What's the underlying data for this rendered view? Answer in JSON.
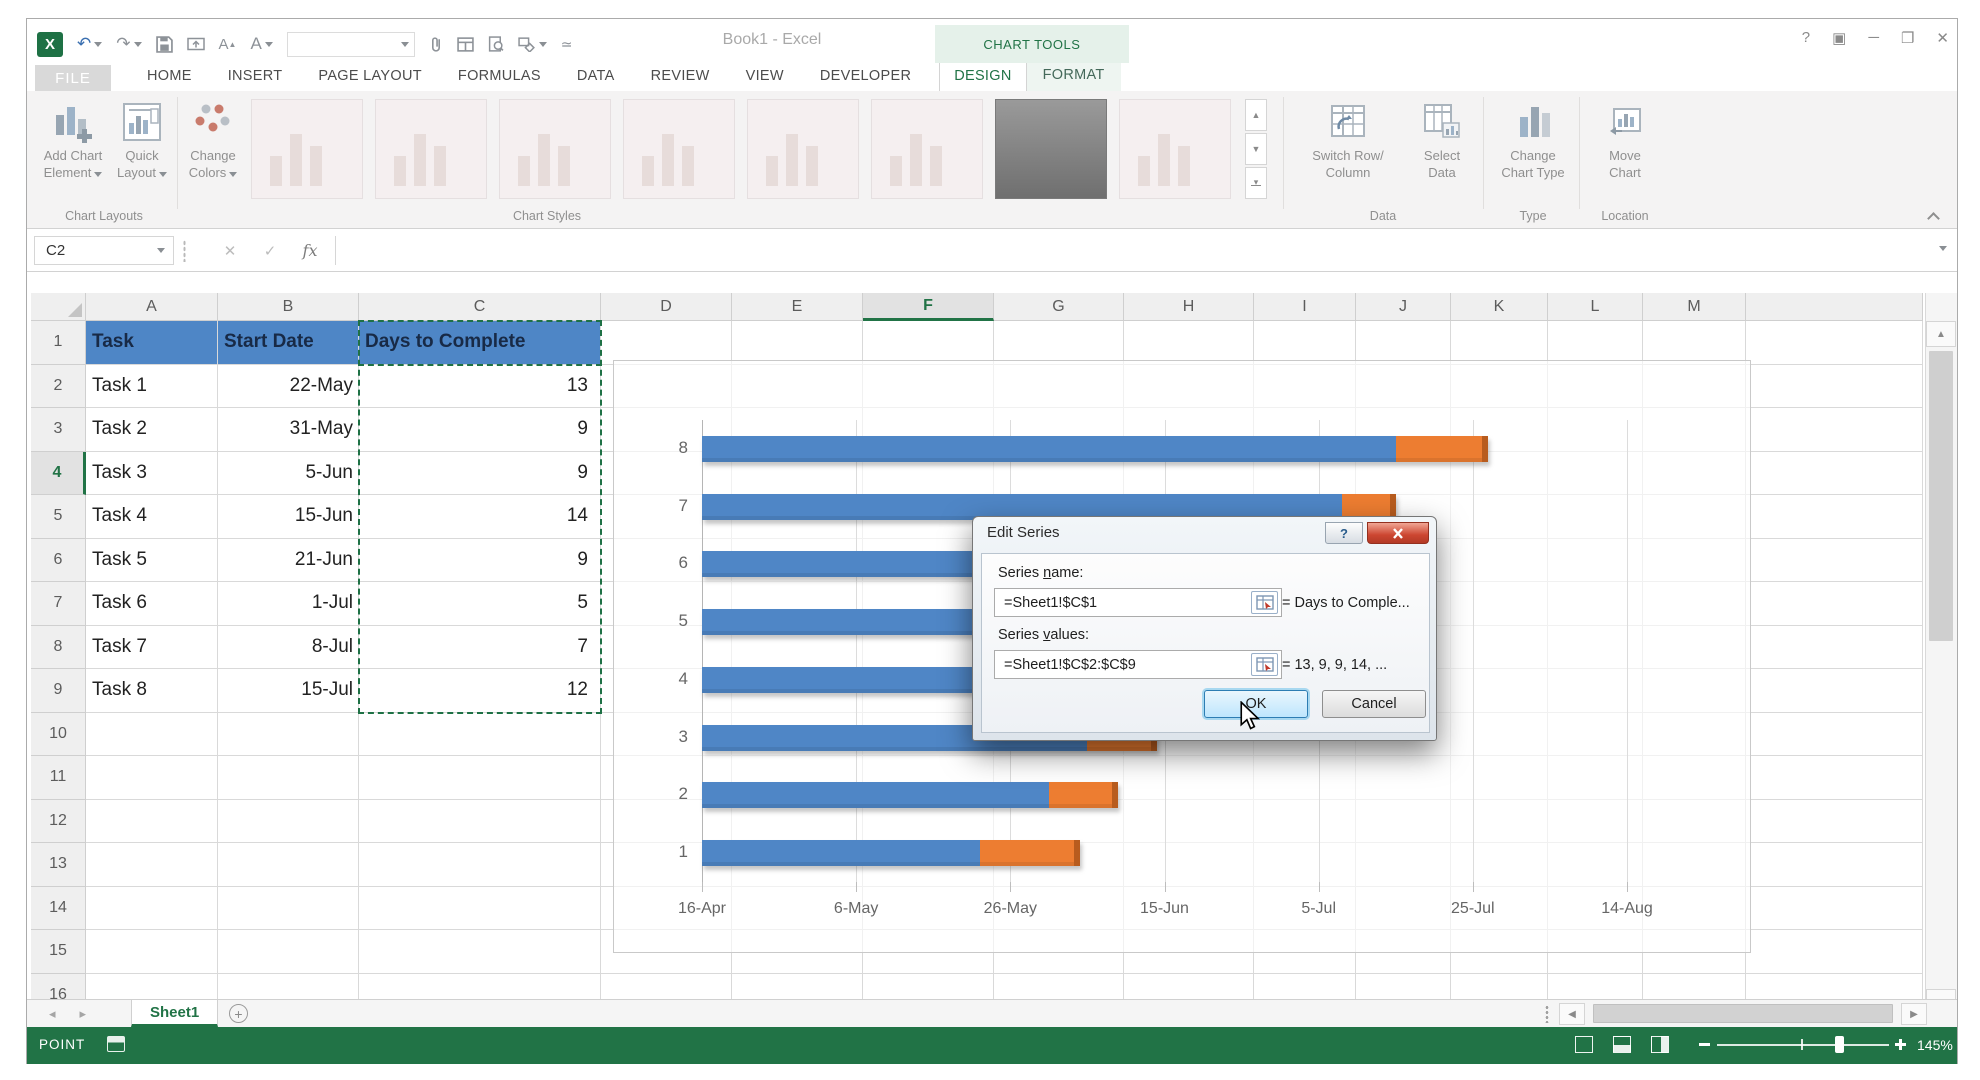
{
  "window": {
    "title": "Book1 - Excel"
  },
  "chart_tools": {
    "label": "CHART TOOLS"
  },
  "qat": {
    "icons": [
      "excel-logo",
      "undo",
      "redo",
      "save",
      "email",
      "font-increase",
      "font-select",
      "font-combo",
      "attach",
      "form",
      "print-preview",
      "shapes",
      "touch-mode"
    ]
  },
  "tabs": {
    "file": "FILE",
    "items": [
      "HOME",
      "INSERT",
      "PAGE LAYOUT",
      "FORMULAS",
      "DATA",
      "REVIEW",
      "VIEW",
      "DEVELOPER",
      "DESIGN",
      "FORMAT"
    ],
    "active": "DESIGN"
  },
  "ribbon": {
    "add_chart_element": [
      "Add Chart",
      "Element"
    ],
    "quick_layout": [
      "Quick",
      "Layout"
    ],
    "change_colors": [
      "Change",
      "Colors"
    ],
    "switch_row_column": [
      "Switch Row/",
      "Column"
    ],
    "select_data": [
      "Select",
      "Data"
    ],
    "change_chart_type": [
      "Change",
      "Chart Type"
    ],
    "move_chart": [
      "Move",
      "Chart"
    ],
    "groups": {
      "chart_layouts": "Chart Layouts",
      "chart_styles": "Chart Styles",
      "data": "Data",
      "type": "Type",
      "location": "Location"
    }
  },
  "formula_bar": {
    "name_box": "C2",
    "formula": ""
  },
  "sheet": {
    "columns": [
      "A",
      "B",
      "C",
      "D",
      "E",
      "F",
      "G",
      "H",
      "I",
      "J",
      "K",
      "L",
      "M"
    ],
    "rows": [
      "1",
      "2",
      "3",
      "4",
      "5",
      "6",
      "7",
      "8",
      "9",
      "10",
      "11",
      "12",
      "13",
      "14",
      "15",
      "16"
    ],
    "selected_column": "F",
    "selected_row": "4",
    "table": {
      "headers": [
        "Task",
        "Start Date",
        "Days to Complete"
      ],
      "rows": [
        [
          "Task 1",
          "22-May",
          "13"
        ],
        [
          "Task 2",
          "31-May",
          "9"
        ],
        [
          "Task 3",
          "5-Jun",
          "9"
        ],
        [
          "Task 4",
          "15-Jun",
          "14"
        ],
        [
          "Task 5",
          "21-Jun",
          "9"
        ],
        [
          "Task 6",
          "1-Jul",
          "5"
        ],
        [
          "Task 7",
          "8-Jul",
          "7"
        ],
        [
          "Task 8",
          "15-Jul",
          "12"
        ]
      ]
    }
  },
  "chart_data": {
    "type": "bar",
    "orientation": "horizontal",
    "title": "",
    "categories": [
      "1",
      "2",
      "3",
      "4",
      "5",
      "6",
      "7",
      "8"
    ],
    "series": [
      {
        "name": "Start Date",
        "color": "#4F86C6",
        "role": "offset days from 16-Apr",
        "values": [
          36,
          45,
          50,
          60,
          66,
          76,
          83,
          90
        ]
      },
      {
        "name": "Days to Complete",
        "color": "#ED7D31",
        "values": [
          13,
          9,
          9,
          14,
          9,
          5,
          7,
          12
        ]
      }
    ],
    "x_ticks": [
      "16-Apr",
      "6-May",
      "26-May",
      "15-Jun",
      "5-Jul",
      "25-Jul",
      "14-Aug"
    ],
    "x_tick_interval_days": 20,
    "x_range_days": 120,
    "gridlines": true,
    "legend": "none"
  },
  "dialog": {
    "title": "Edit Series",
    "help_glyph": "?",
    "series_name_label": [
      "Series ",
      "n",
      "ame:"
    ],
    "series_name_value": "=Sheet1!$C$1",
    "series_name_preview": "= Days to Comple...",
    "series_values_label": [
      "Series ",
      "v",
      "alues:"
    ],
    "series_values_value": "=Sheet1!$C$2:$C$9",
    "series_values_preview": "= 13, 9, 9, 14, ...",
    "ok_label": "OK",
    "cancel_label": "Cancel"
  },
  "sheet_tabs": {
    "active": "Sheet1",
    "add_label": "+"
  },
  "status_bar": {
    "mode": "POINT",
    "zoom_level": "145%"
  },
  "colors": {
    "excel_green": "#217346",
    "bar_blue": "#4F86C6",
    "bar_orange": "#ED7D31",
    "table_header_fill": "#4E86C6",
    "ants_green": "#1E7145"
  }
}
